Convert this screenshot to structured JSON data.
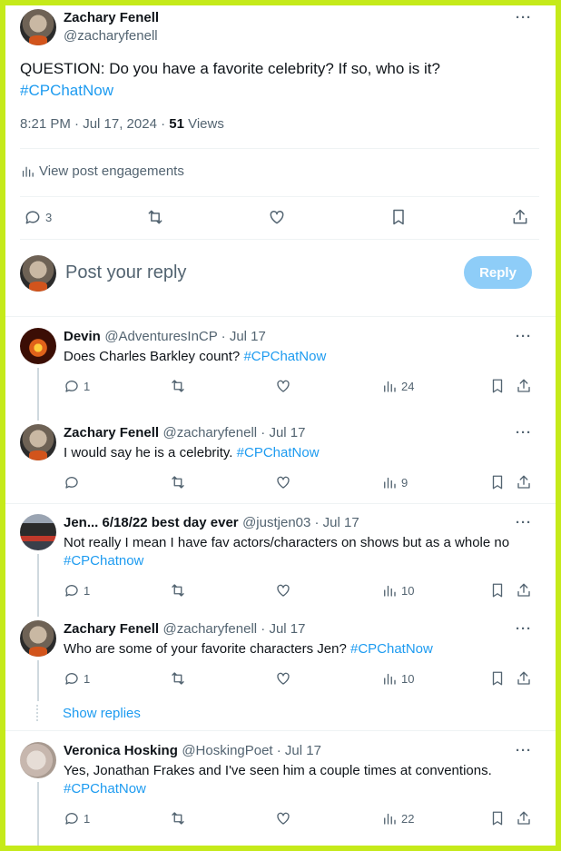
{
  "main_post": {
    "author_name": "Zachary Fenell",
    "author_handle": "@zacharyfenell",
    "text": "QUESTION: Do you have a favorite celebrity? If so, who is it?",
    "hashtag": "#CPChatNow",
    "time": "8:21 PM · Jul 17, 2024 · ",
    "views_count": "51",
    "views_label": " Views",
    "engagements_label": "View post engagements",
    "reply_count": "3",
    "more": "···"
  },
  "composer": {
    "placeholder": "Post your reply",
    "button_label": "Reply"
  },
  "replies": [
    {
      "name": "Devin",
      "handle": "@AdventuresInCP · Jul 17",
      "text": "Does Charles Barkley count? ",
      "hashtag": "#CPChatNow",
      "replies": "1",
      "views": "24"
    },
    {
      "name": "Zachary Fenell",
      "handle": "@zacharyfenell · Jul 17",
      "text": "I would say he is a celebrity. ",
      "hashtag": "#CPChatNow",
      "replies": "",
      "views": "9"
    },
    {
      "name": "Jen... 6/18/22 best day ever",
      "handle": "@justjen03 · Jul 17",
      "text": "Not really I mean I have fav actors/characters on shows but as a whole no",
      "hashtag": "#CPChatnow",
      "replies": "1",
      "views": "10"
    },
    {
      "name": "Zachary Fenell",
      "handle": "@zacharyfenell · Jul 17",
      "text": "Who are some of your favorite characters Jen? ",
      "hashtag": "#CPChatNow",
      "replies": "1",
      "views": "10"
    },
    {
      "name": "Veronica Hosking",
      "handle": "@HoskingPoet · Jul 17",
      "text": "Yes, Jonathan Frakes and I've seen him a couple times at conventions.",
      "hashtag": "#CPChatNow",
      "replies": "1",
      "views": "22"
    }
  ],
  "show_replies_label": "Show replies",
  "more": "···",
  "colors": {
    "accent": "#1d9bf0",
    "frame": "#c5ea1a",
    "reply_button": "#8ecdf8"
  }
}
